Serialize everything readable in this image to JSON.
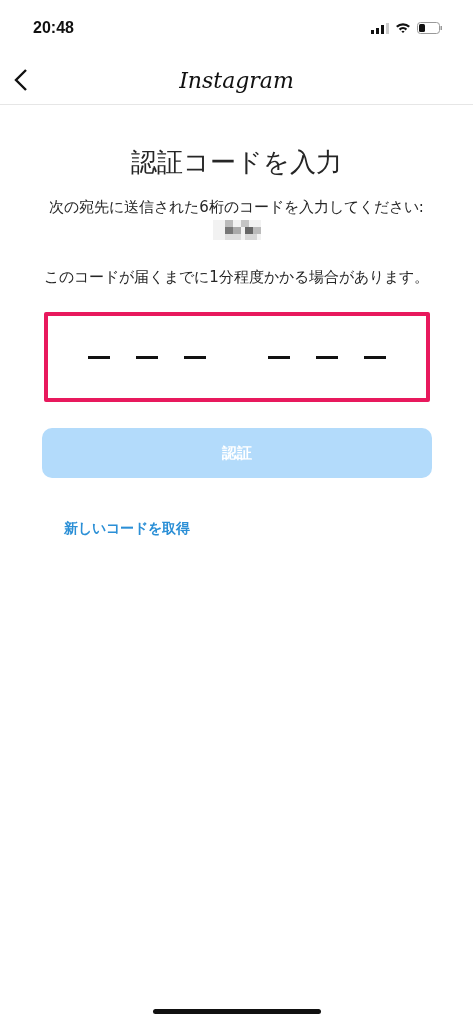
{
  "status_bar": {
    "time": "20:48"
  },
  "nav": {
    "title": "Instagram"
  },
  "heading": "認証コードを入力",
  "instruction": "次の宛先に送信された6桁のコードを入力してください:",
  "note": "このコードが届くまでに1分程度かかる場合があります。",
  "code_field": {
    "highlighted": true,
    "digits": [
      {
        "filled": false
      },
      {
        "filled": false
      },
      {
        "filled": false
      },
      {
        "filled": false
      },
      {
        "filled": false
      },
      {
        "filled": false
      }
    ]
  },
  "confirm_button": {
    "label": "認証",
    "disabled": true
  },
  "resend_link": "新しいコードを取得"
}
